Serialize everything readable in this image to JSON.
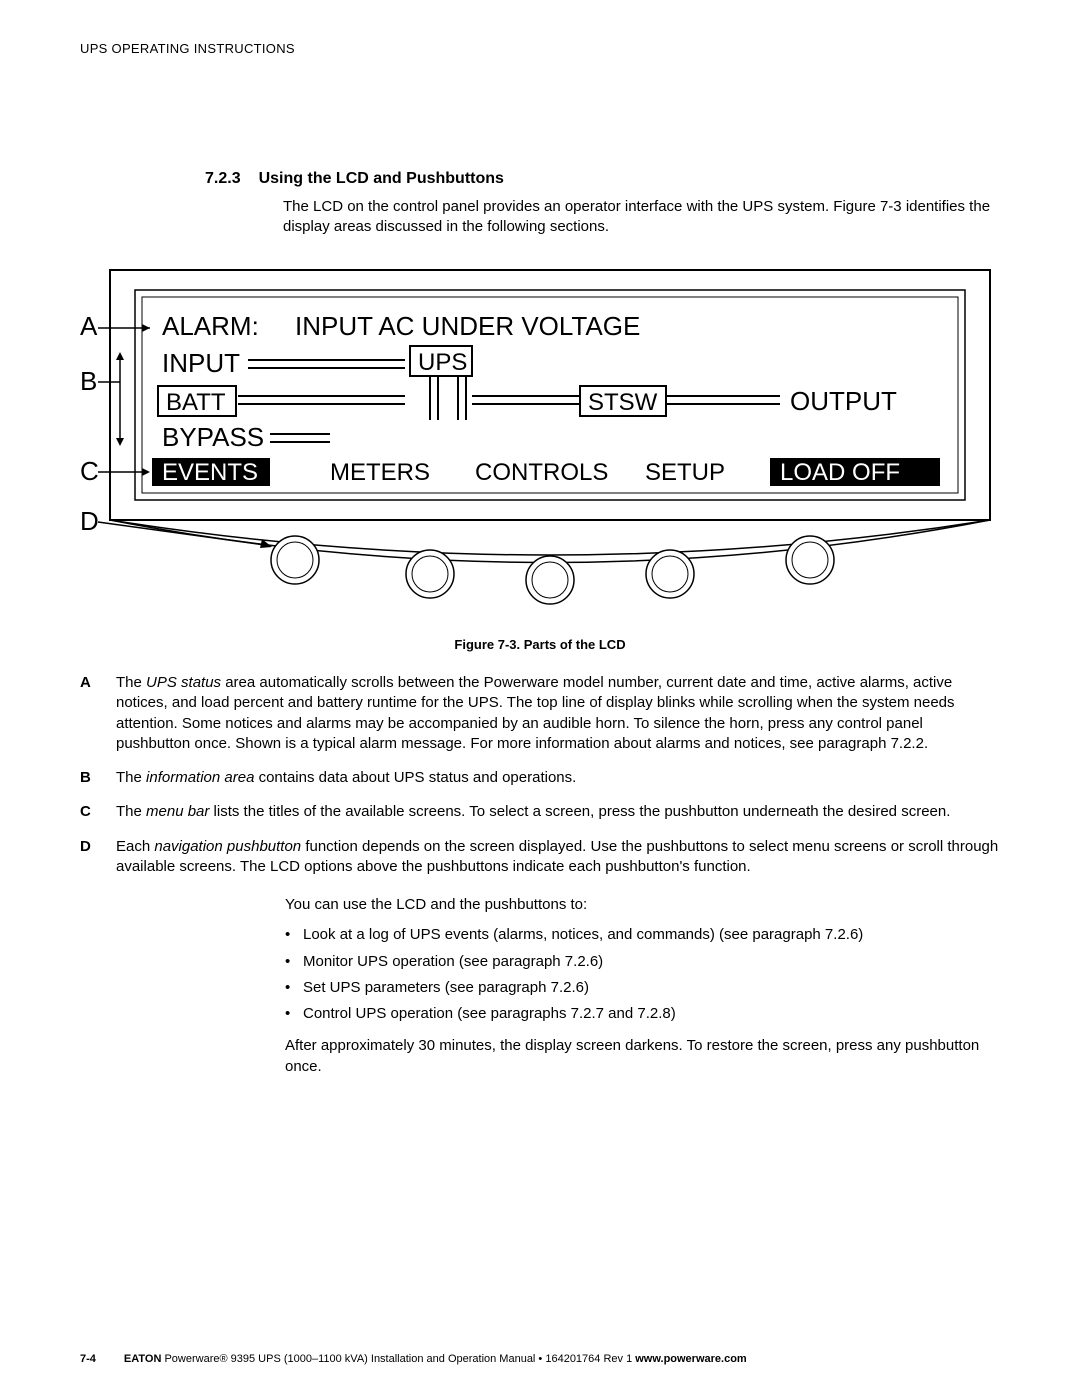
{
  "header": "UPS OPERATING INSTRUCTIONS",
  "section": {
    "number": "7.2.3",
    "title": "Using the LCD and Pushbuttons",
    "intro": "The LCD on the control panel provides an operator interface with the UPS system. Figure 7-3 identifies the display areas discussed in the following sections."
  },
  "figure": {
    "caption": "Figure 7-3. Parts of the LCD",
    "callouts": {
      "A": "A",
      "B": "B",
      "C": "C",
      "D": "D"
    },
    "alarm_line": "ALARM:   INPUT  AC  UNDER  VOLTAGE",
    "alarm_label": "ALARM:",
    "alarm_msg": "INPUT  AC  UNDER  VOLTAGE",
    "info": {
      "input": "INPUT",
      "ups": "UPS",
      "batt": "BATT",
      "stsw": "STSW",
      "output": "OUTPUT",
      "bypass": "BYPASS"
    },
    "menu": {
      "events": "EVENTS",
      "meters": "METERS",
      "controls": "CONTROLS",
      "setup": "SETUP",
      "load_off": "LOAD OFF"
    }
  },
  "definitions": {
    "A": {
      "label": "A",
      "term": "UPS status",
      "text_before": "The ",
      "text_after": " area automatically scrolls between the Powerware model number, current date and time, active alarms, active notices, and load percent and battery runtime for the UPS. The top line of display blinks while scrolling when the system needs attention. Some notices and alarms may be accompanied by an audible horn. To silence the horn, press any control panel pushbutton once. Shown is a typical alarm message. For more information about alarms and notices, see paragraph 7.2.2."
    },
    "B": {
      "label": "B",
      "term": "information area",
      "text_before": "The ",
      "text_after": " contains data about UPS status and operations."
    },
    "C": {
      "label": "C",
      "term": "menu bar",
      "text_before": "The ",
      "text_after": " lists the titles of the available screens. To select a screen, press the pushbutton underneath the desired screen."
    },
    "D": {
      "label": "D",
      "term": "navigation pushbutton",
      "text_before": "Each ",
      "text_after": " function depends on the screen displayed. Use the pushbuttons to select menu screens or scroll through available screens. The LCD options above the pushbuttons indicate each pushbutton's function."
    }
  },
  "usage": {
    "lead": "You can use the LCD and the pushbuttons to:",
    "bullets": [
      "Look at a log of UPS events (alarms, notices, and commands) (see paragraph 7.2.6)",
      "Monitor UPS operation (see paragraph 7.2.6)",
      "Set UPS parameters (see paragraph 7.2.6)",
      "Control UPS operation (see paragraphs 7.2.7 and 7.2.8)"
    ],
    "trailer": "After approximately 30 minutes, the display screen darkens. To restore the screen, press any pushbutton once."
  },
  "footer": {
    "page": "7-4",
    "brand": "EATON",
    "rest": " Powerware® 9395 UPS (1000–1100 kVA) Installation and Operation Manual  •  164201764 Rev 1 ",
    "url": "www.powerware.com"
  }
}
